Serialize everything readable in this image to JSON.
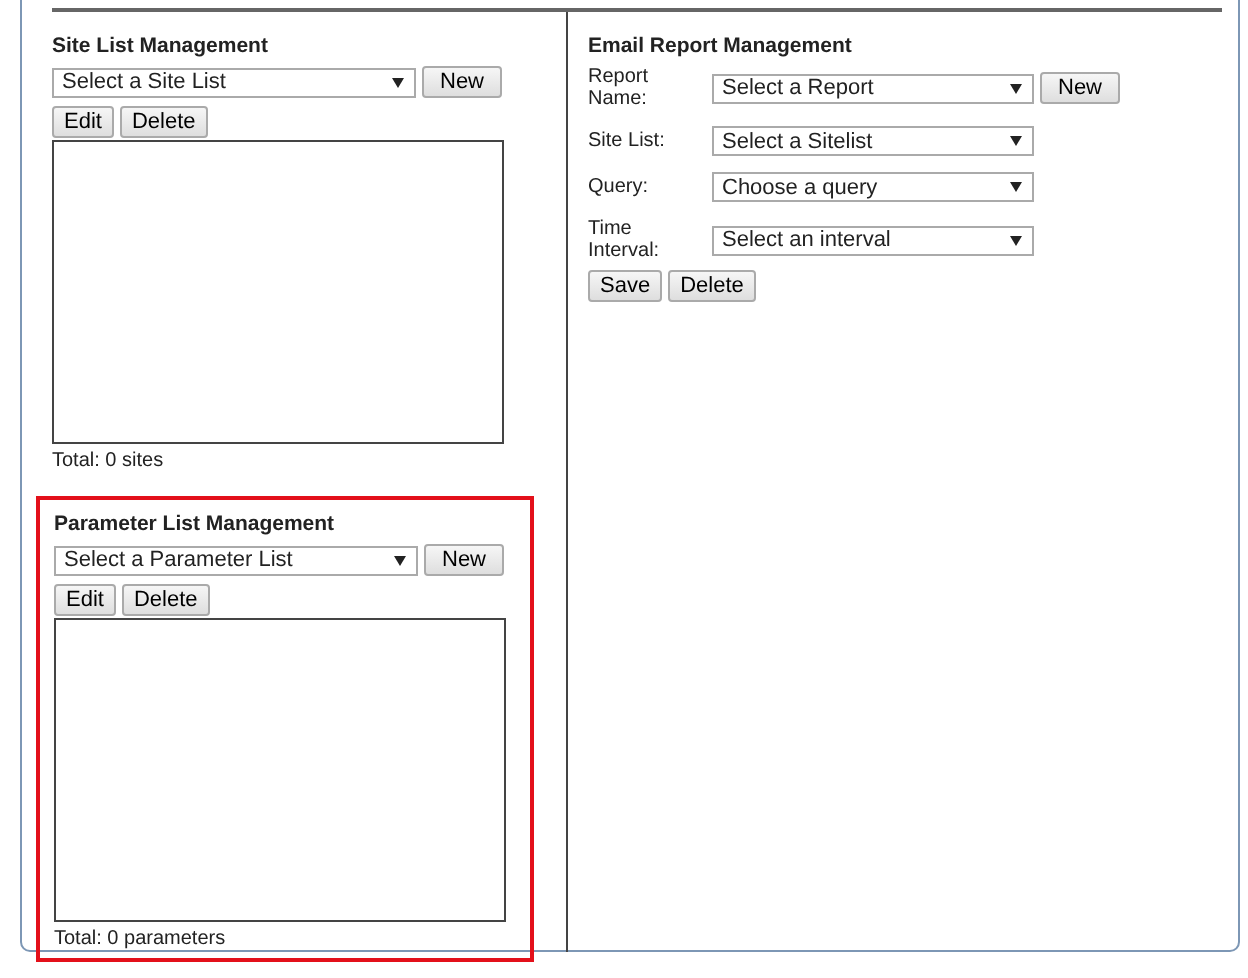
{
  "site_list": {
    "title": "Site List Management",
    "select_placeholder": "Select a Site List",
    "new_button": "New",
    "edit_button": "Edit",
    "delete_button": "Delete",
    "total": "Total: 0 sites",
    "highlighted": false
  },
  "parameter_list": {
    "title": "Parameter List Management",
    "select_placeholder": "Select a Parameter List",
    "new_button": "New",
    "edit_button": "Edit",
    "delete_button": "Delete",
    "total": "Total: 0 parameters",
    "highlighted": true
  },
  "email_report": {
    "title": "Email Report Management",
    "fields": [
      {
        "label": "Report Name:",
        "value": "Select a Report",
        "button": "New"
      },
      {
        "label": "Site List:",
        "value": "Select a Sitelist"
      },
      {
        "label": "Query:",
        "value": "Choose a query"
      },
      {
        "label": "Time Interval:",
        "value": "Select an interval"
      }
    ],
    "save_button": "Save",
    "delete_button": "Delete"
  }
}
